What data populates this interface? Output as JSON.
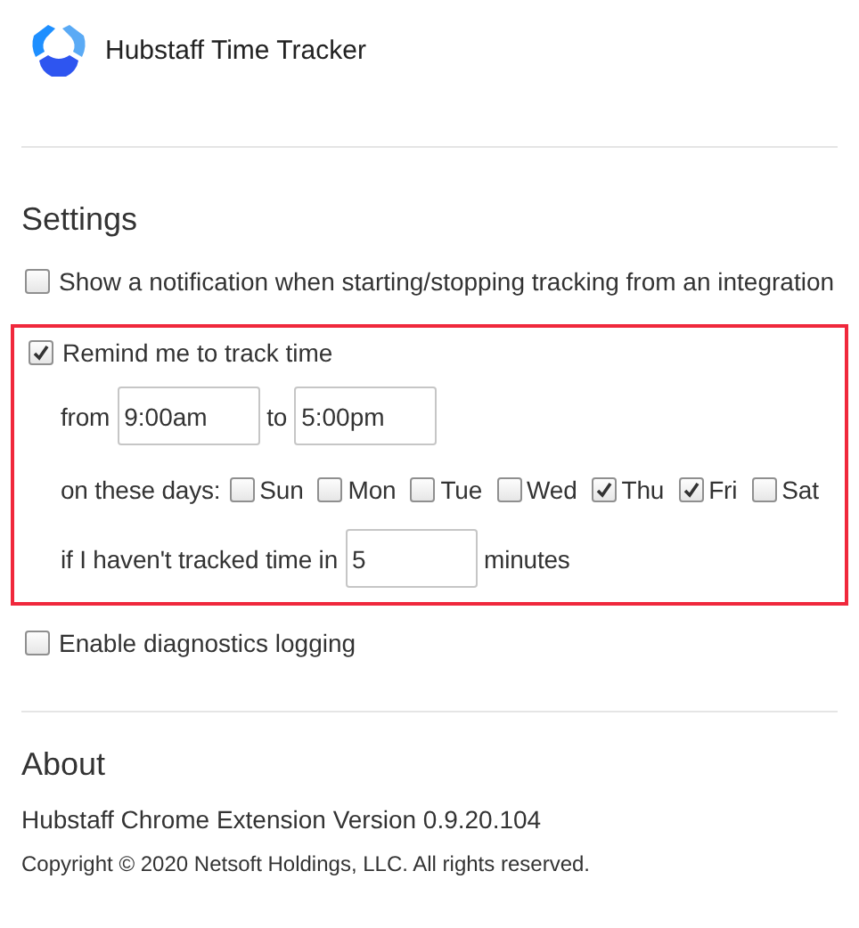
{
  "header": {
    "title": "Hubstaff Time Tracker"
  },
  "settings": {
    "heading": "Settings",
    "notification": {
      "label": "Show a notification when starting/stopping tracking from an integration",
      "checked": false
    },
    "reminder": {
      "label": "Remind me to track time",
      "checked": true,
      "highlighted": true,
      "from_label": "from",
      "from_value": "9:00am",
      "to_label": "to",
      "to_value": "5:00pm",
      "days_label": "on these days:",
      "days": [
        {
          "label": "Sun",
          "checked": false
        },
        {
          "label": "Mon",
          "checked": false
        },
        {
          "label": "Tue",
          "checked": false
        },
        {
          "label": "Wed",
          "checked": false
        },
        {
          "label": "Thu",
          "checked": true
        },
        {
          "label": "Fri",
          "checked": true
        },
        {
          "label": "Sat",
          "checked": false
        }
      ],
      "idle_label": "if I haven't tracked time in",
      "idle_value": "5",
      "idle_unit": "minutes"
    },
    "diagnostics": {
      "label": "Enable diagnostics logging",
      "checked": false
    }
  },
  "about": {
    "heading": "About",
    "version": "Hubstaff Chrome Extension Version 0.9.20.104",
    "copyright": "Copyright © 2020 Netsoft Holdings, LLC. All rights reserved."
  }
}
